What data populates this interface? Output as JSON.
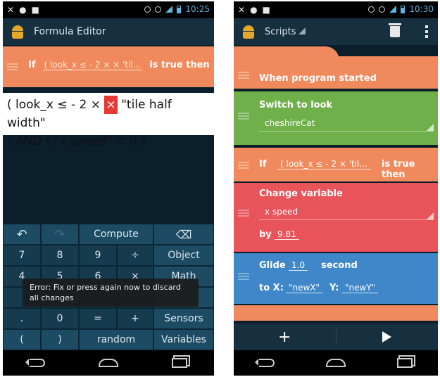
{
  "left": {
    "status_time": "10:25",
    "app_title": "Formula Editor",
    "if_brick": {
      "label_if": "If",
      "condition": "( look_x ≤ - 2 × × 'til...",
      "label_true": "is true then"
    },
    "formula": {
      "part1": "( look_x ≤ - 2 × ",
      "cursor": "×",
      "part2": " \"tile half width\"",
      "line2": ") AND ( \"x speed\" < 0 )"
    },
    "keys": {
      "undo": "↶",
      "redo": "↷",
      "compute": "Compute",
      "backspace": "⌫",
      "k7": "7",
      "k8": "8",
      "k9": "9",
      "div": "÷",
      "object": "Object",
      "k4": "4",
      "k5": "5",
      "k6": "6",
      "mul": "×",
      "math": "Math",
      "dot": ".",
      "k0": "0",
      "eq": "=",
      "plus": "+",
      "sensors": "Sensors",
      "lparen": "(",
      "rparen": ")",
      "random": "random",
      "variables": "Variables"
    },
    "toast": "Error: Fix or press again now to discard all changes"
  },
  "right": {
    "status_time": "10:30",
    "spinner_label": "Scripts",
    "bricks": {
      "when_started": "When program started",
      "switch_look": "Switch to look",
      "look_value": "cheshireCat",
      "if_label": "If",
      "if_condition": "( look_x ≤ - 2 × 'til...",
      "if_true": "is true then",
      "change_var": "Change variable",
      "var_name": "x speed",
      "by_label": "by",
      "by_value": "9.81",
      "glide_label": "Glide",
      "glide_value": "1.0",
      "second_label": "second",
      "to_x_label": "to X:",
      "x_value": "\"newX\"",
      "y_label": "Y:",
      "y_value": "\"newY\""
    },
    "bottom": {
      "add": "+"
    }
  },
  "colors": {
    "orange": "#f08a5d",
    "green": "#6fb04a",
    "red": "#e9535a",
    "blue": "#3f87c9",
    "keypad": "#1d4b63",
    "actionbar": "#17303f"
  }
}
